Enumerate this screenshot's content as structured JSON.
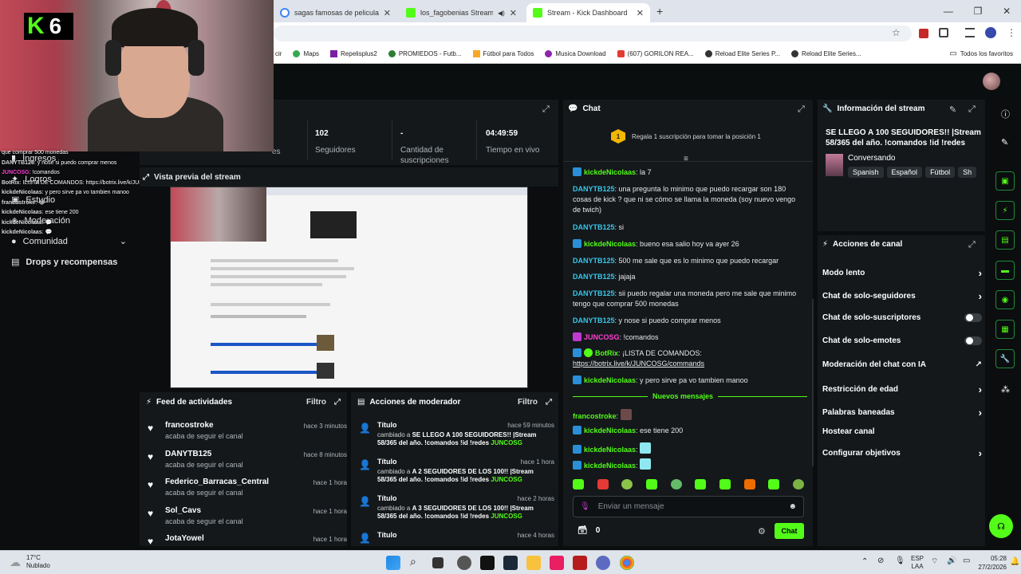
{
  "browser": {
    "tabs": [
      {
        "title": "sagas famosas de peliculas - Bu",
        "icon_color": "#4285f4"
      },
      {
        "title": "los_fagobenias Stream - Wa",
        "icon_color": "#53fc18"
      },
      {
        "title": "Stream - Kick Dashboard",
        "icon_color": "#53fc18"
      }
    ],
    "bookmarks": [
      {
        "label": "cir",
        "icon_color": "#888"
      },
      {
        "label": "Maps",
        "icon_color": "#34a853"
      },
      {
        "label": "Repelisplus2",
        "icon_color": "#7b1fa2"
      },
      {
        "label": "PROMIEDOS - Futb...",
        "icon_color": "#2e7d32"
      },
      {
        "label": "Fútbol para Todos",
        "icon_color": "#f9a825"
      },
      {
        "label": "Musica Download",
        "icon_color": "#8e24aa"
      },
      {
        "label": "(607) GORILON REA...",
        "icon_color": "#e53935"
      },
      {
        "label": "Reload Elite Series P...",
        "icon_color": "#333"
      },
      {
        "label": "Reload Elite Series...",
        "icon_color": "#333"
      }
    ],
    "all_favorites": "Todos los favoritos"
  },
  "webcam": {
    "badge_letter": "K",
    "badge_number": "6"
  },
  "overlay_chat": [
    {
      "user": "",
      "text": "que comprar 500 monedas"
    },
    {
      "user": "DANYTB125",
      "text": ": y nose si puedo comprar menos"
    },
    {
      "user": "JUNCOSG",
      "text": ": !comandos"
    },
    {
      "user": "BotRix",
      "text": ": ILISTA DE COMANDOS: https://botrix.live/k/JUNCOSG/commands"
    },
    {
      "user": "kickdeNicolaas",
      "text": ": y pero sirve pa vo tambien manoo"
    },
    {
      "user": "francostroke",
      "text": ": 😂"
    },
    {
      "user": "kickdeNicolaas",
      "text": ": ese tiene 200"
    },
    {
      "user": "kickdeNicolaas",
      "text": ": 💬"
    },
    {
      "user": "kickdeNicolaas",
      "text": ": 💬"
    }
  ],
  "sidebar": {
    "items": [
      {
        "label": "Ingresos"
      },
      {
        "label": "Logros"
      },
      {
        "label": "Estudio"
      },
      {
        "label": "Moderación"
      },
      {
        "label": "Comunidad"
      },
      {
        "label": "Drops y recompensas"
      }
    ]
  },
  "stats": [
    {
      "value": "",
      "label": "es"
    },
    {
      "value": "102",
      "label": "Seguidores"
    },
    {
      "value": "-",
      "label": "Cantidad de suscripciones"
    },
    {
      "value": "04:49:59",
      "label": "Tiempo en vivo"
    }
  ],
  "preview": {
    "title": "Vista previa del stream"
  },
  "feed": {
    "title": "Feed de actividades",
    "filter": "Filtro",
    "items": [
      {
        "name": "francostroke",
        "action": "acaba de seguir el canal",
        "time": "hace 3 minutos"
      },
      {
        "name": "DANYTB125",
        "action": "acaba de seguir el canal",
        "time": "hace 8 minutos"
      },
      {
        "name": "Federico_Barracas_Central",
        "action": "acaba de seguir el canal",
        "time": "hace 1 hora"
      },
      {
        "name": "Sol_Cavs",
        "action": "acaba de seguir el canal",
        "time": "hace 1 hora"
      },
      {
        "name": "JotaYowel",
        "action": "",
        "time": "hace 1 hora"
      }
    ]
  },
  "mod": {
    "title": "Acciones de moderador",
    "filter": "Filtro",
    "items": [
      {
        "title": "Título",
        "time": "hace 59 minutos",
        "prefix": "cambiado a",
        "value": "SE LLEGO A 100 SEGUIDORES!! |Stream 58/365 del año. !comandos !id !redes",
        "by": "JUNCOSG"
      },
      {
        "title": "Título",
        "time": "hace 1 hora",
        "prefix": "cambiado a",
        "value": "A 2 SEGUIDORES DE LOS 100!! |Stream 58/365 del año. !comandos !id !redes",
        "by": "JUNCOSG"
      },
      {
        "title": "Título",
        "time": "hace 2 horas",
        "prefix": "cambiado a",
        "value": "A 3 SEGUIDORES DE LOS 100!! |Stream 58/365 del año. !comandos !id !redes",
        "by": "JUNCOSG"
      },
      {
        "title": "Título",
        "time": "hace 4 horas",
        "prefix": "",
        "value": "",
        "by": ""
      }
    ]
  },
  "chat": {
    "title": "Chat",
    "pinned_rank": "1",
    "pinned_text": "Regala 1 suscripción para tomar la posición 1",
    "new_messages": "Nuevos mensajes",
    "input_placeholder": "Enviar un mensaje",
    "points": "0",
    "send_label": "Chat",
    "messages": [
      {
        "user": "kickdeNicolaas",
        "text": ": la 7",
        "color": "#53fc18",
        "badge": "#2a8fd6"
      },
      {
        "user": "DANYTB125",
        "text": ": una pregunta lo minimo que puedo recargar son 180 cosas de kick ? que ni se cómo se llama la moneda (soy nuevo vengo de twich)",
        "color": "#39c6e9",
        "badge": ""
      },
      {
        "user": "DANYTB125",
        "text": ": si",
        "color": "#39c6e9",
        "badge": ""
      },
      {
        "user": "kickdeNicolaas",
        "text": ": bueno esa salio hoy va ayer 26",
        "color": "#53fc18",
        "badge": "#2a8fd6"
      },
      {
        "user": "DANYTB125",
        "text": ": 500 me sale que es lo minimo que puedo recargar",
        "color": "#39c6e9",
        "badge": ""
      },
      {
        "user": "DANYTB125",
        "text": ": jajaja",
        "color": "#39c6e9",
        "badge": ""
      },
      {
        "user": "DANYTB125",
        "text": ": sii puedo regalar una moneda pero me sale que minimo tengo que comprar 500 monedas",
        "color": "#39c6e9",
        "badge": ""
      },
      {
        "user": "DANYTB125",
        "text": ": y nose si puedo comprar menos",
        "color": "#39c6e9",
        "badge": ""
      },
      {
        "user": "JUNCOSG",
        "text": ": !comandos",
        "color": "#ff3fd2",
        "badge": "#c03ad0"
      },
      {
        "user": "BotRix",
        "text": ": ¡LISTA DE COMANDOS:",
        "link": "https://botrix.live/k/JUNCOSG/commands",
        "color": "#53fc18",
        "badge": "#2a8fd6"
      },
      {
        "user": "kickdeNicolaas",
        "text": ": y pero sirve pa vo tambien manoo",
        "color": "#53fc18",
        "badge": "#2a8fd6"
      },
      {
        "user": "francostroke",
        "text": ":",
        "color": "#53fc18",
        "badge": ""
      },
      {
        "user": "kickdeNicolaas",
        "text": ": ese tiene 200",
        "color": "#53fc18",
        "badge": "#2a8fd6"
      },
      {
        "user": "kickdeNicolaas",
        "text": ":",
        "color": "#53fc18",
        "badge": "#2a8fd6"
      },
      {
        "user": "kickdeNicolaas",
        "text": ":",
        "color": "#53fc18",
        "badge": "#2a8fd6"
      }
    ]
  },
  "info": {
    "title": "Información del stream",
    "stream_title": "SE LLEGO A 100 SEGUIDORES!! |Stream 58/365 del año. !comandos !id !redes",
    "category": "Conversando",
    "tags": [
      "Spanish",
      "Español",
      "Fútbol",
      "Sh"
    ]
  },
  "actions": {
    "title": "Acciones de canal",
    "items": [
      {
        "label": "Modo lento",
        "control": "chevron"
      },
      {
        "label": "Chat de solo-seguidores",
        "control": "chevron"
      },
      {
        "label": "Chat de solo-suscriptores",
        "control": "toggle"
      },
      {
        "label": "Chat de solo-emotes",
        "control": "toggle"
      },
      {
        "label": "Moderación del chat con IA",
        "control": "external"
      },
      {
        "label": "Restricción de edad",
        "control": "chevron"
      },
      {
        "label": "Palabras baneadas",
        "control": "chevron"
      },
      {
        "label": "Hostear canal",
        "control": "none"
      },
      {
        "label": "Configurar objetivos",
        "control": "chevron"
      }
    ]
  },
  "taskbar": {
    "weather_temp": "17°C",
    "weather_desc": "Nublado",
    "lang": "ESP",
    "lang2": "LAA",
    "time": "05:28",
    "date": "27/2/2026"
  },
  "colors": {
    "accent": "#53fc18",
    "panel": "#14181b",
    "bg": "#0b0d0f"
  }
}
